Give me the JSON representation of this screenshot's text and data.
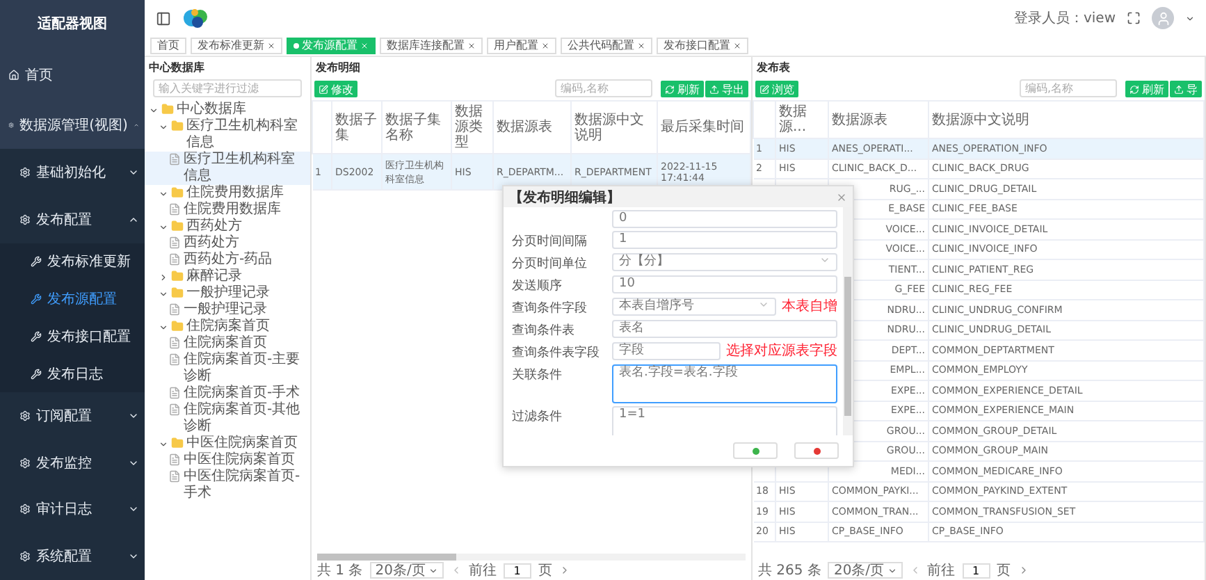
{
  "sidebar": {
    "title": "适配器视图",
    "items": [
      {
        "label": "首页",
        "selected": false
      },
      {
        "label": "数据源管理(视图)",
        "expanded": true,
        "children": [
          {
            "label": "基础初始化",
            "expanded": false
          },
          {
            "label": "发布配置",
            "expanded": true,
            "children": [
              {
                "label": "发布标准更新",
                "selected": false
              },
              {
                "label": "发布源配置",
                "selected": true
              },
              {
                "label": "发布接口配置",
                "selected": false
              },
              {
                "label": "发布日志",
                "selected": false
              }
            ]
          },
          {
            "label": "订阅配置",
            "expanded": false
          },
          {
            "label": "发布监控",
            "expanded": false
          },
          {
            "label": "审计日志",
            "expanded": false
          },
          {
            "label": "系统配置",
            "expanded": false
          }
        ]
      }
    ]
  },
  "header": {
    "user_label": "登录人员：view"
  },
  "tabs": [
    {
      "label": "首页",
      "closable": false,
      "selected": false
    },
    {
      "label": "发布标准更新",
      "closable": true,
      "selected": false
    },
    {
      "label": "发布源配置",
      "closable": true,
      "selected": true
    },
    {
      "label": "数据库连接配置",
      "closable": true,
      "selected": false
    },
    {
      "label": "用户配置",
      "closable": true,
      "selected": false
    },
    {
      "label": "公共代码配置",
      "closable": true,
      "selected": false
    },
    {
      "label": "发布接口配置",
      "closable": true,
      "selected": false
    }
  ],
  "tree_panel": {
    "title": "中心数据库",
    "search": {
      "placeholder": "输入关键字进行过滤"
    },
    "tree": [
      {
        "label": "中心数据库",
        "kind": "folder",
        "expanded": true,
        "children": [
          {
            "label": "医疗卫生机构科室信息",
            "kind": "folder",
            "expanded": true,
            "children": [
              {
                "label": "医疗卫生机构科室信息",
                "kind": "file",
                "selected": true
              }
            ]
          },
          {
            "label": "住院费用数据库",
            "kind": "folder",
            "expanded": true,
            "children": [
              {
                "label": "住院费用数据库",
                "kind": "file",
                "selected": false
              }
            ]
          },
          {
            "label": "西药处方",
            "kind": "folder",
            "expanded": true,
            "children": [
              {
                "label": "西药处方",
                "kind": "file",
                "selected": false
              },
              {
                "label": "西药处方-药品",
                "kind": "file",
                "selected": false
              }
            ]
          },
          {
            "label": "麻醉记录",
            "kind": "folder",
            "expanded": false
          },
          {
            "label": "一般护理记录",
            "kind": "folder",
            "expanded": true,
            "children": [
              {
                "label": "一般护理记录",
                "kind": "file",
                "selected": false
              }
            ]
          },
          {
            "label": "住院病案首页",
            "kind": "folder",
            "expanded": true,
            "children": [
              {
                "label": "住院病案首页",
                "kind": "file",
                "selected": false
              },
              {
                "label": "住院病案首页-主要诊断",
                "kind": "file",
                "selected": false
              },
              {
                "label": "住院病案首页-手术",
                "kind": "file",
                "selected": false
              },
              {
                "label": "住院病案首页-其他诊断",
                "kind": "file",
                "selected": false
              }
            ]
          },
          {
            "label": "中医住院病案首页",
            "kind": "folder",
            "expanded": true,
            "children": [
              {
                "label": "中医住院病案首页",
                "kind": "file",
                "selected": false
              },
              {
                "label": "中医住院病案首页-手术",
                "kind": "file",
                "selected": false
              }
            ]
          }
        ]
      }
    ]
  },
  "detail_panel": {
    "title": "发布明细",
    "edit_button": "修改",
    "search": {
      "placeholder": "编码,名称"
    },
    "refresh_button": "刷新",
    "export_button": "导出",
    "columns": [
      "数据子集",
      "数据子集名称",
      "数据源类型",
      "数据源表",
      "数据源中文说明",
      "最后采集时间"
    ],
    "rows": [
      {
        "index": "1",
        "selected": true,
        "cells": [
          "DS2002",
          "医疗卫生机构科室信息",
          "HIS",
          "R_DEPARTM...",
          "R_DEPARTMENT",
          "2022-11-15 17:41:44"
        ]
      }
    ],
    "pagination": {
      "total": "共 1 条",
      "page_size": "20条/页",
      "goto": "前往",
      "page": "1",
      "page_suffix": "页"
    }
  },
  "table_panel": {
    "title": "发布表",
    "browse_button": "浏览",
    "search": {
      "placeholder": "编码,名称"
    },
    "refresh_button": "刷新",
    "export_button": "导",
    "columns": [
      "数据源...",
      "数据源表",
      "数据源中文说明"
    ],
    "rows": [
      {
        "kind": "full",
        "index": "1",
        "selected": true,
        "type": "HIS",
        "table": "ANES_OPERATI...",
        "desc": "ANES_OPERATION_INFO"
      },
      {
        "kind": "full",
        "index": "2",
        "selected": false,
        "type": "HIS",
        "table": "CLINIC_BACK_D...",
        "desc": "CLINIC_BACK_DRUG"
      },
      {
        "kind": "partial",
        "selected": false,
        "table": "RUG_...",
        "desc": "CLINIC_DRUG_DETAIL"
      },
      {
        "kind": "partial",
        "selected": false,
        "table": "E_BASE",
        "desc": "CLINIC_FEE_BASE"
      },
      {
        "kind": "partial",
        "selected": false,
        "table": "VOICE...",
        "desc": "CLINIC_INVOICE_DETAIL"
      },
      {
        "kind": "partial",
        "selected": false,
        "table": "VOICE...",
        "desc": "CLINIC_INVOICE_INFO"
      },
      {
        "kind": "partial",
        "selected": false,
        "table": "TIENT...",
        "desc": "CLINIC_PATIENT_REG"
      },
      {
        "kind": "partial",
        "selected": false,
        "table": "G_FEE",
        "desc": "CLINIC_REG_FEE"
      },
      {
        "kind": "partial",
        "selected": false,
        "table": "NDRU...",
        "desc": "CLINIC_UNDRUG_CONFIRM"
      },
      {
        "kind": "partial",
        "selected": false,
        "table": "NDRU...",
        "desc": "CLINIC_UNDRUG_DETAIL"
      },
      {
        "kind": "partial",
        "selected": false,
        "table": "DEPT...",
        "desc": "COMMON_DEPTARTMENT"
      },
      {
        "kind": "partial",
        "selected": false,
        "table": "EMPL...",
        "desc": "COMMON_EMPLOYY"
      },
      {
        "kind": "partial",
        "selected": false,
        "table": "EXPE...",
        "desc": "COMMON_EXPERIENCE_DETAIL"
      },
      {
        "kind": "partial",
        "selected": false,
        "table": "EXPE...",
        "desc": "COMMON_EXPERIENCE_MAIN"
      },
      {
        "kind": "partial",
        "selected": false,
        "table": "GROU...",
        "desc": "COMMON_GROUP_DETAIL"
      },
      {
        "kind": "partial",
        "selected": false,
        "table": "GROU...",
        "desc": "COMMON_GROUP_MAIN"
      },
      {
        "kind": "partial",
        "selected": false,
        "table": "MEDI...",
        "desc": "COMMON_MEDICARE_INFO"
      },
      {
        "kind": "full",
        "index": "18",
        "selected": false,
        "type": "HIS",
        "table": "COMMON_PAYKI...",
        "desc": "COMMON_PAYKIND_EXTENT"
      },
      {
        "kind": "full",
        "index": "19",
        "selected": false,
        "type": "HIS",
        "table": "COMMON_TRAN...",
        "desc": "COMMON_TRANSFUSION_SET"
      },
      {
        "kind": "full",
        "index": "20",
        "selected": false,
        "type": "HIS",
        "table": "CP_BASE_INFO",
        "desc": "CP_BASE_INFO"
      }
    ],
    "pagination": {
      "total": "共 265 条",
      "page_size": "20条/页",
      "goto": "前往",
      "page": "1",
      "page_suffix": "页"
    }
  },
  "dialog": {
    "title": "【发布明细编辑】",
    "fields": [
      {
        "kind": "input",
        "value": "0",
        "focused": false
      },
      {
        "label": "分页时间间隔",
        "kind": "input",
        "value": "1",
        "focused": false
      },
      {
        "label": "分页时间单位",
        "kind": "select",
        "value": "分【分】",
        "focused": false
      },
      {
        "label": "发送顺序",
        "kind": "input",
        "value": "10",
        "focused": false
      },
      {
        "label": "查询条件字段",
        "kind": "select",
        "value": "本表自增序号",
        "focused": false,
        "note": "本表自增"
      },
      {
        "label": "查询条件表",
        "kind": "input",
        "value": "表名",
        "focused": false
      },
      {
        "label": "查询条件表字段",
        "kind": "input",
        "value": "字段",
        "focused": false,
        "note": "选择对应源表字段"
      },
      {
        "label": "关联条件",
        "kind": "textarea",
        "value": "表名.字段=表名.字段",
        "focused": true
      },
      {
        "label": "过滤条件",
        "kind": "textarea",
        "value": "1=1",
        "focused": false
      }
    ]
  }
}
